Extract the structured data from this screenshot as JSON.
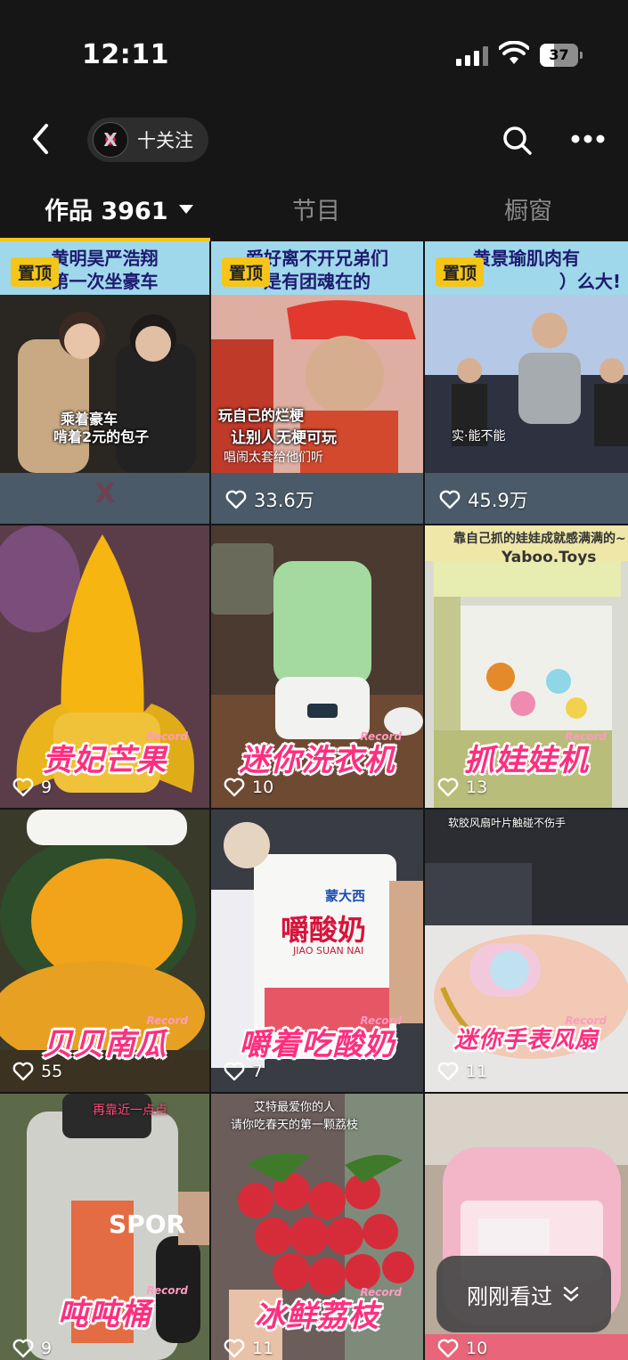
{
  "status_bar": {
    "time": "12:11",
    "battery": "37",
    "battery_level": 0.37
  },
  "nav": {
    "follow_label": "十关注"
  },
  "tabs": [
    {
      "label": "作品 3961",
      "active": true
    },
    {
      "label": "节目",
      "active": false
    },
    {
      "label": "橱窗",
      "active": false
    }
  ],
  "pinned_badge": "置顶",
  "items": [
    {
      "top_title": [
        "黄明昊严浩翔",
        "第一次坐豪车"
      ],
      "captions": [
        "乘着豪车",
        "啃着2元的包子"
      ],
      "likes": ""
    },
    {
      "top_title": [
        "爱好离不开兄弟们",
        "是有团魂在的"
      ],
      "captions": [
        "玩自己的烂梗",
        "让别人无梗可玩",
        "唱闹太套给他们听"
      ],
      "likes": "33.6万"
    },
    {
      "top_title": [
        "黄景瑜肌肉有",
        "）么大!"
      ],
      "captions": [
        "实·能不能"
      ],
      "likes": "45.9万"
    },
    {
      "overlay": "贵妃芒果",
      "record": "Record",
      "likes": "9"
    },
    {
      "overlay": "迷你洗衣机",
      "record": "Record",
      "likes": "10"
    },
    {
      "overlay": "抓娃娃机",
      "record": "Record",
      "likes": "13",
      "top_banner": "靠自己抓的娃娃成就感满满的~",
      "brand": "Yaboo.Toys"
    },
    {
      "overlay": "贝贝南瓜",
      "record": "Record",
      "likes": "55"
    },
    {
      "overlay": "嚼着吃酸奶",
      "record": "Record",
      "likes": "7",
      "pack_text": "嚼酸奶",
      "pack_sub": "JIAO SUAN NAI",
      "pack_brand": "蒙大西"
    },
    {
      "overlay": "迷你手表风扇",
      "record": "Record",
      "likes": "11",
      "top_caption": "软胶风扇叶片触碰不伤手"
    },
    {
      "overlay": "吨吨桶",
      "record": "Record",
      "likes": "9",
      "top_caption": "再靠近一点点",
      "bottle_text": "SPOR"
    },
    {
      "overlay": "冰鲜荔枝",
      "record": "Record",
      "likes": "11",
      "top_caption": [
        "艾特最爱你的人",
        "请你吃春天的第一颗荔枝"
      ]
    },
    {
      "overlay": "",
      "record": "",
      "likes": "10"
    }
  ],
  "just_watched": "刚刚看过",
  "colors": {
    "accent": "#f5c518",
    "overlay_pink": "#ff2f7d",
    "background": "#161616"
  }
}
